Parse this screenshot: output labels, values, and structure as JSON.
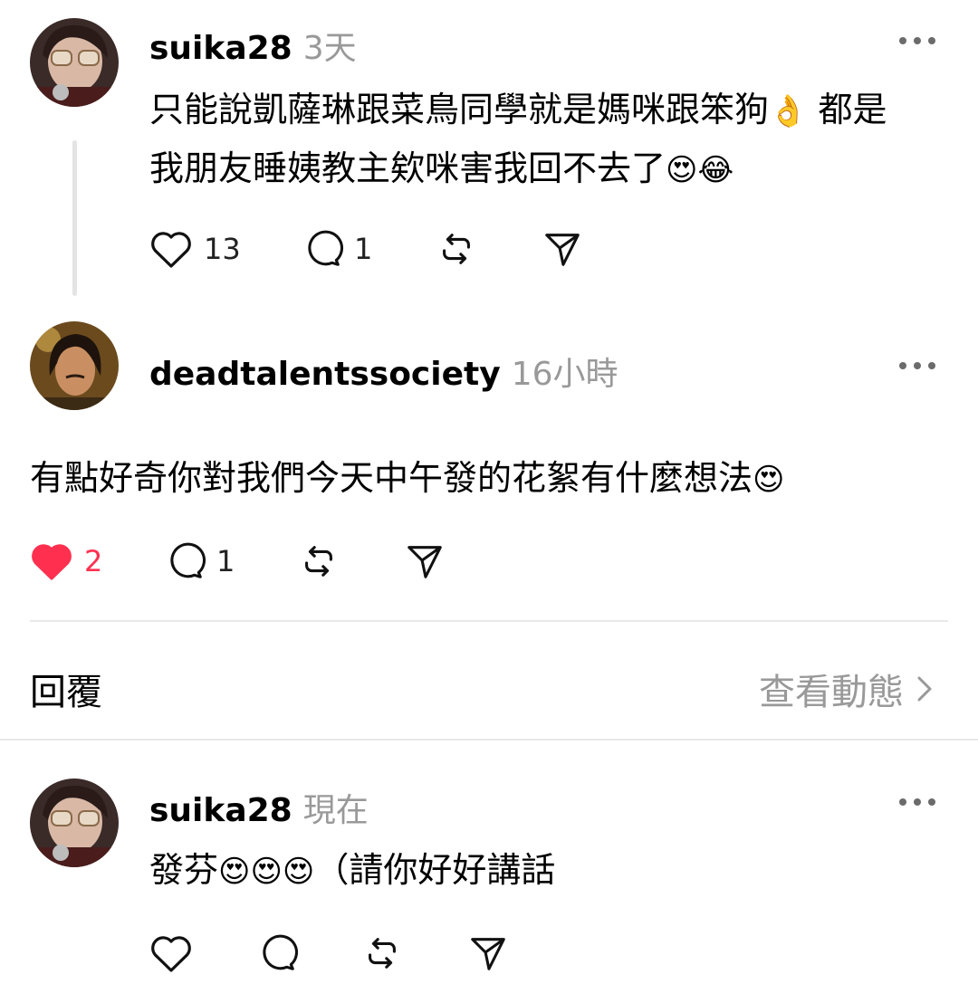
{
  "comments": [
    {
      "username": "suika28",
      "time": "3天",
      "text_line1": "只能說凱薩琳跟菜鳥同學就是媽咪跟笨狗",
      "emoji1": "👌",
      "text_line1b": " 都是",
      "text_line2": "我朋友睡姨教主欸咪害我回不去了",
      "emoji2": "😍😂",
      "likes": "13",
      "replies": "1",
      "liked": false
    },
    {
      "username": "deadtalentssociety",
      "time": "16小時",
      "text": "有點好奇你對我們今天中午發的花絮有什麼想法",
      "emoji": "😍",
      "likes": "2",
      "replies": "1",
      "liked": true
    },
    {
      "username": "suika28",
      "time": "現在",
      "text_a": "發芬",
      "emoji": "😍😍😍",
      "text_b": "（請你好好講話",
      "likes": "",
      "replies": "",
      "liked": false
    }
  ],
  "reply_bar": {
    "reply_label": "回覆",
    "view_activity_label": "查看動態"
  },
  "colors": {
    "liked_red": "#ff304f",
    "muted_gray": "#999999",
    "divider": "#e9e9e9"
  }
}
